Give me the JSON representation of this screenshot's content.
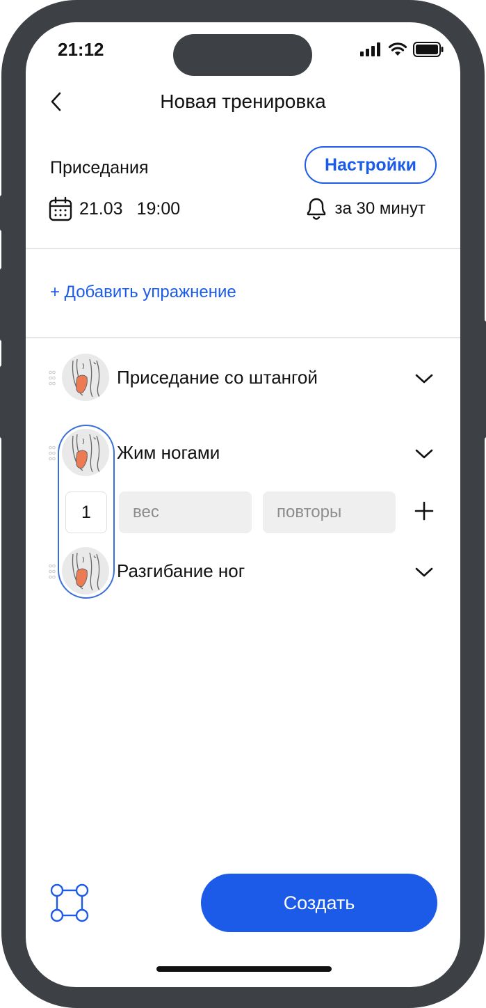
{
  "status_bar": {
    "time": "21:12"
  },
  "nav": {
    "title": "Новая тренировка"
  },
  "workout": {
    "name": "Приседания",
    "settings_label": "Настройки",
    "date": "21.03",
    "time": "19:00",
    "reminder": "за 30 минут"
  },
  "add_exercise_label": "+ Добавить упражнение",
  "exercises": [
    {
      "name": "Приседание со штангой"
    },
    {
      "name": "Жим ногами"
    },
    {
      "name": "Разгибание ног"
    }
  ],
  "set": {
    "number": "1",
    "weight_placeholder": "вес",
    "reps_placeholder": "повторы"
  },
  "create_label": "Создать",
  "colors": {
    "accent": "#1b5be8",
    "muscle": "#ec7b54",
    "frame": "#3d4045"
  }
}
